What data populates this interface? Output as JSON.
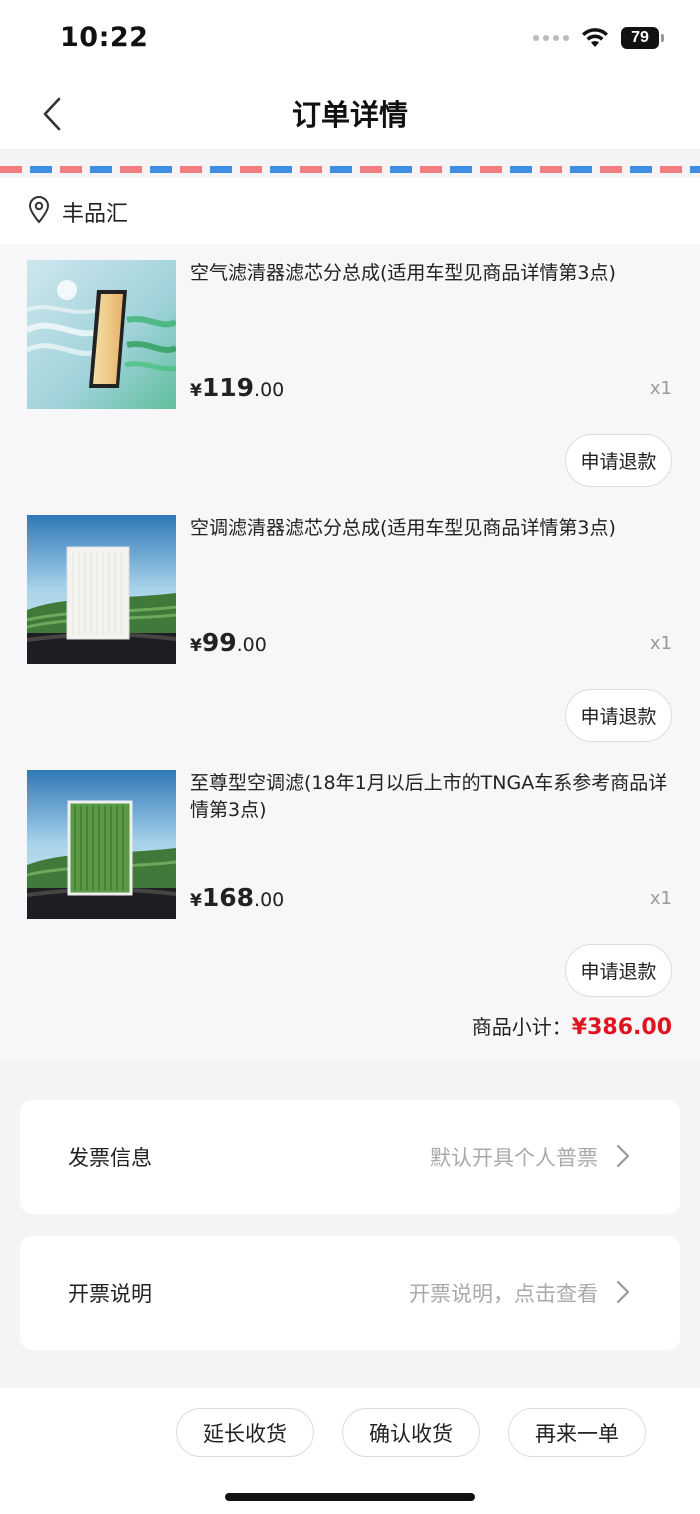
{
  "status_bar": {
    "time": "10:22",
    "battery": "79"
  },
  "nav": {
    "title": "订单详情"
  },
  "store": {
    "name": "丰品汇"
  },
  "items": [
    {
      "name": "空气滤清器滤芯分总成(适用车型见商品详情第3点)",
      "currency": "¥",
      "price_int": "119",
      "price_dec": ".00",
      "qty": "x1",
      "refund_label": "申请退款",
      "image": "air-filter-product-image"
    },
    {
      "name": "空调滤清器滤芯分总成(适用车型见商品详情第3点)",
      "currency": "¥",
      "price_int": "99",
      "price_dec": ".00",
      "qty": "x1",
      "refund_label": "申请退款",
      "image": "cabin-filter-product-image"
    },
    {
      "name": "至尊型空调滤(18年1月以后上市的TNGA车系参考商品详情第3点)",
      "currency": "¥",
      "price_int": "168",
      "price_dec": ".00",
      "qty": "x1",
      "refund_label": "申请退款",
      "image": "premium-cabin-filter-product-image"
    }
  ],
  "subtotal": {
    "label": "商品小计：",
    "amount": "¥386.00"
  },
  "invoice": {
    "label": "发票信息",
    "value": "默认开具个人普票"
  },
  "invoice_note": {
    "label": "开票说明",
    "value": "开票说明，点击查看"
  },
  "actions": {
    "extend": "延长收货",
    "confirm": "确认收货",
    "reorder": "再来一单"
  },
  "colors": {
    "price_red": "#e0141e",
    "stripe_red": "#f27d7f",
    "stripe_blue": "#3d8fe6"
  }
}
